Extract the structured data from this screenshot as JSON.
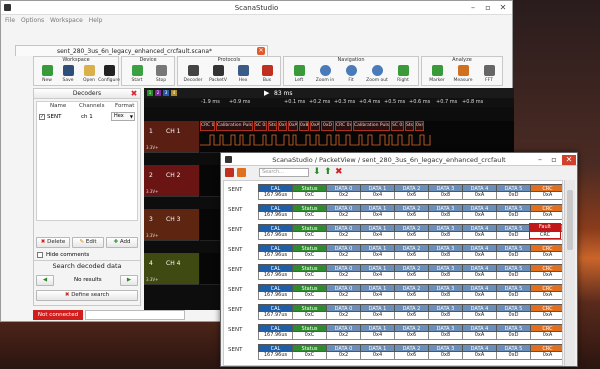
{
  "app_title": "ScanaStudio",
  "menu": [
    "File",
    "Options",
    "Workspace",
    "Help"
  ],
  "document_tab": "sent_280_3us_6n_legacy_enhanced_crcfault.scana*",
  "toolbar": {
    "groups": [
      {
        "label": "Workspace",
        "buttons": [
          "New",
          "Save",
          "Open",
          "Configure"
        ]
      },
      {
        "label": "Device",
        "buttons": [
          "Start",
          "Stop"
        ]
      },
      {
        "label": "Protocols",
        "buttons": [
          "Decoder",
          "PacketV",
          "Hex",
          "Bus"
        ]
      },
      {
        "label": "Navigation",
        "buttons": [
          "Left",
          "Zoom in",
          "Fit",
          "Zoom out",
          "Right"
        ]
      },
      {
        "label": "Analyze",
        "buttons": [
          "Marker",
          "Measure",
          "FFT"
        ]
      }
    ]
  },
  "decoders": {
    "title": "Decoders",
    "columns": [
      "Name",
      "Channels",
      "Format"
    ],
    "rows": [
      {
        "checked": true,
        "name": "SENT",
        "channel": "ch 1",
        "format": "Hex"
      }
    ],
    "delete_label": "Delete",
    "edit_label": "Edit",
    "add_label": "Add",
    "hide_comments_label": "Hide comments"
  },
  "search": {
    "title": "Search decoded data",
    "results": "No results",
    "define_label": "Define search"
  },
  "status": "Not connected",
  "waveform": {
    "swatches": [
      "1",
      "2",
      "3",
      "4"
    ],
    "marker_label": "83 ms",
    "ticks": [
      "-1.9 ms",
      "+0.9 ms",
      "+0.1 ms",
      "+0.2 ms",
      "+0.3 ms",
      "+0.4 ms",
      "+0.5 ms",
      "+0.6 ms",
      "+0.7 ms",
      "+0.8 ms"
    ],
    "channels": [
      {
        "num": "1",
        "name": "CH 1",
        "volt": "3.3V+",
        "color": "#5a1f12"
      },
      {
        "num": "2",
        "name": "CH 2",
        "volt": "3.3V+",
        "color": "#6a1414"
      },
      {
        "num": "3",
        "name": "CH 3",
        "volt": "3.3V+",
        "color": "#5e2510"
      },
      {
        "num": "4",
        "name": "CH 4",
        "volt": "3.3V+",
        "color": "#3e4a12"
      }
    ],
    "decoded": [
      "CRC 0xA",
      "Calibration Pulse",
      "SC 0x8",
      "Sts2",
      "0x4",
      "0xA",
      "0x8",
      "0xA",
      "0xD",
      "CRC 0xA",
      "Calibration Pulse",
      "SC 0x8",
      "Sts2",
      "0x4"
    ]
  },
  "packetview": {
    "title": "ScanaStudio / PacketView / sent_280_3us_6n_legacy_enhanced_crcfault",
    "search_placeholder": "Search...",
    "header_labels": [
      "CAL",
      "Status",
      "DATA 0",
      "DATA 1",
      "DATA 2",
      "DATA 3",
      "DATA 4",
      "DATA 5",
      "CRC"
    ],
    "header_colors": [
      "#1e5fa8",
      "#2e8b2e",
      "#6b8fb8",
      "#6b8fb8",
      "#6b8fb8",
      "#6b8fb8",
      "#6b8fb8",
      "#6b8fb8",
      "#e07020"
    ],
    "fault": {
      "label": "Fault",
      "value": "CRC"
    },
    "rows": [
      {
        "label": "SENT",
        "cells": [
          "167.96us",
          "0xC",
          "0x2",
          "0x4",
          "0x6",
          "0x8",
          "0xA",
          "0xD",
          "0xA"
        ]
      },
      {
        "label": "SENT",
        "cells": [
          "167.96us",
          "0xC",
          "0x2",
          "0x4",
          "0x6",
          "0x8",
          "0xA",
          "0xD",
          "0xA"
        ]
      },
      {
        "label": "SENT",
        "cells": [
          "167.96us",
          "0xC",
          "0x2",
          "0x4",
          "0x6",
          "0x8",
          "0xA",
          "0xD",
          "0xA"
        ]
      },
      {
        "label": "SENT",
        "cells": [
          "167.96us",
          "0xC",
          "0x2",
          "0x4",
          "0x6",
          "0x8",
          "0xA",
          "0xD",
          "0xA"
        ]
      },
      {
        "label": "SENT",
        "cells": [
          "167.96us",
          "0xC",
          "0x2",
          "0x4",
          "0x6",
          "0x8",
          "0xA",
          "0xD",
          "0xA"
        ]
      },
      {
        "label": "SENT",
        "cells": [
          "167.96us",
          "0xC",
          "0x2",
          "0x4",
          "0x6",
          "0x8",
          "0xA",
          "0xD",
          "0xA"
        ]
      },
      {
        "label": "SENT",
        "cells": [
          "167.97us",
          "0xC",
          "0x2",
          "0x4",
          "0x6",
          "0x8",
          "0xA",
          "0xD",
          "0xA"
        ]
      },
      {
        "label": "SENT",
        "cells": [
          "167.96us",
          "0xC",
          "0x2",
          "0x4",
          "0x6",
          "0x8",
          "0xA",
          "0xD",
          "0xA"
        ]
      },
      {
        "label": "SENT",
        "cells": [
          "167.96us",
          "0xC",
          "0x2",
          "0x4",
          "0x6",
          "0x8",
          "0xA",
          "0xD",
          "0xA"
        ]
      }
    ]
  }
}
